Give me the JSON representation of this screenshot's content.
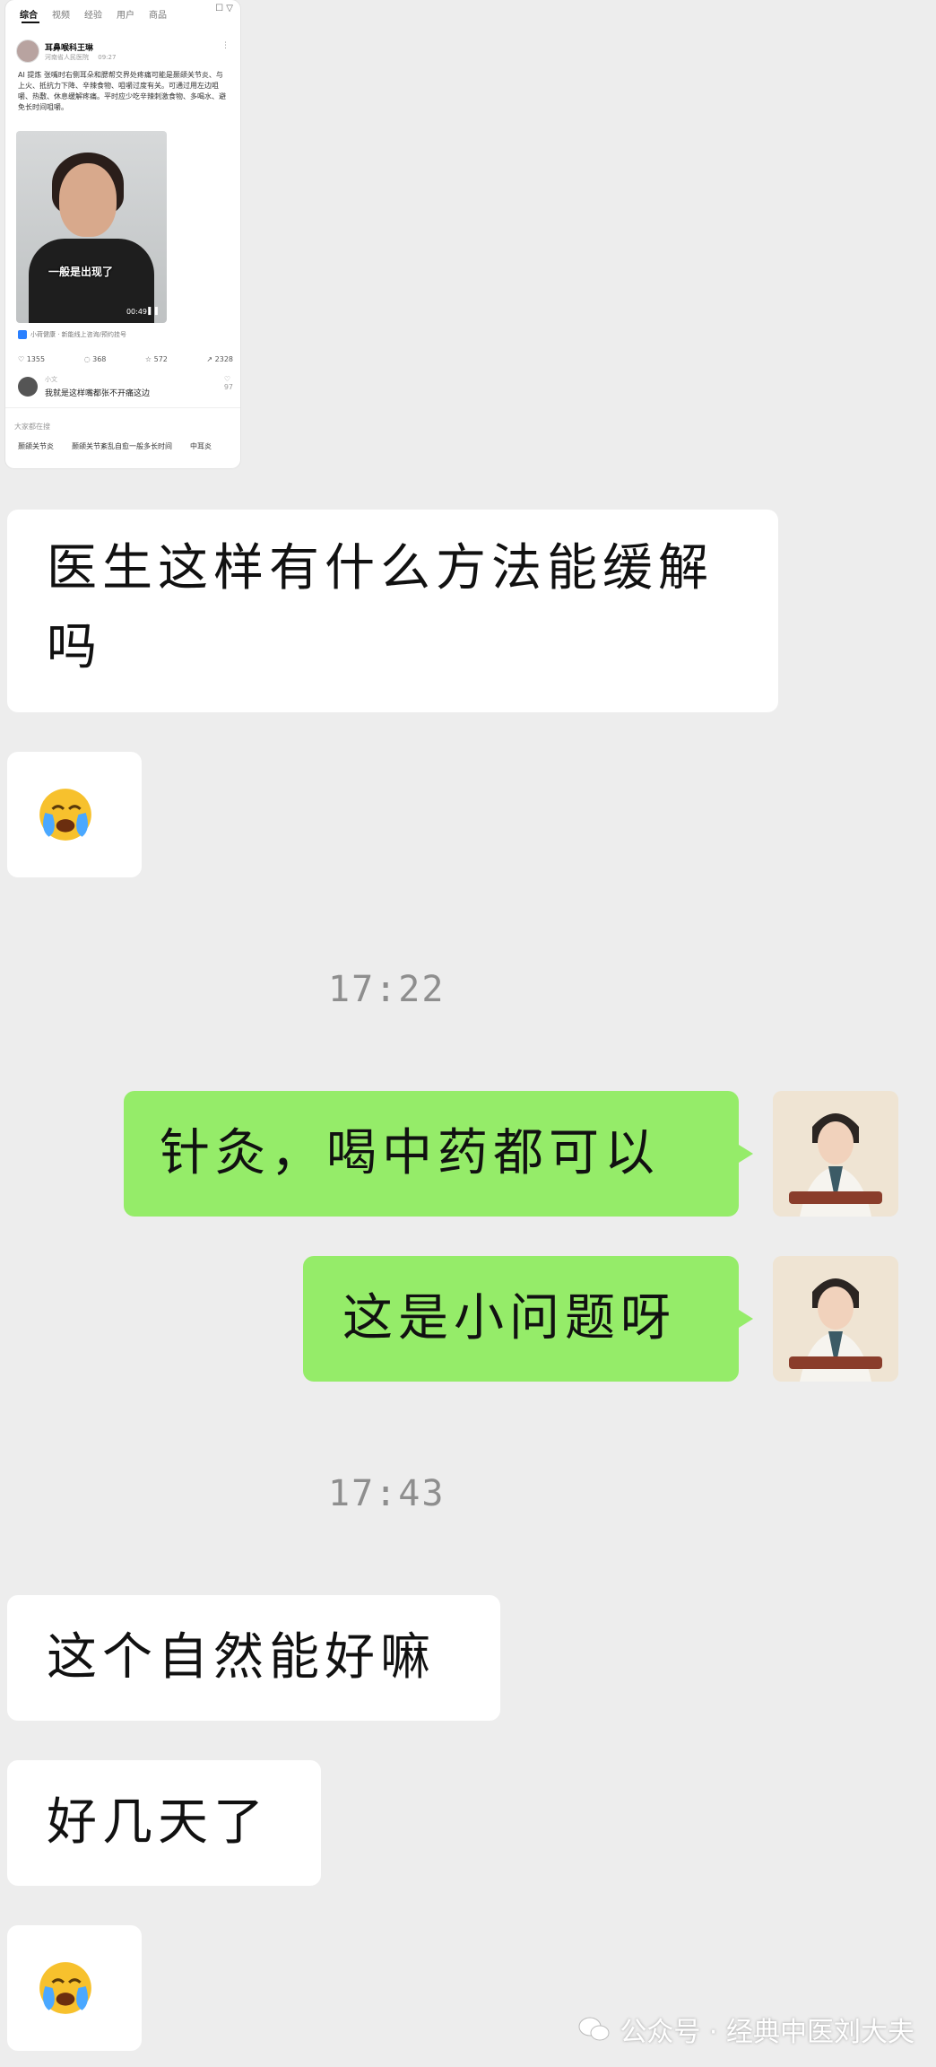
{
  "shared_post": {
    "tabs": [
      "综合",
      "视频",
      "经验",
      "用户",
      "商品"
    ],
    "author": "耳鼻喉科王琳",
    "author_meta": "河南省人民医院",
    "post_time": "09:27",
    "text": "AI 提炼 张嘴时右侧耳朵和腮帮交界处疼痛可能是颞颌关节炎、与上火、抵抗力下降、辛辣食物、咀嚼过度有关。可通过用左边咀嚼、热敷、休息缓解疼痛。平时应少吃辛辣刺激食物、多喝水、避免长时间咀嚼。",
    "video_caption": "一般是出现了",
    "video_time": "00:49",
    "mini_app_label": "小荷健康 · 新能线上咨询/预约挂号",
    "stats": {
      "likes": "1355",
      "comments": "368",
      "favorites": "572",
      "shares": "2328"
    },
    "comment_user": "小文",
    "comment_text": "我就是这样嘴都张不开痛这边",
    "comment_likes": "97",
    "suggest_header": "大家都在搜",
    "suggestions": [
      "颞颌关节炎",
      "颞颌关节紊乱自愈一般多长时间",
      "中耳炎"
    ]
  },
  "messages": {
    "m1": "医生这样有什么方法能缓解吗",
    "m3": "针灸，喝中药都可以",
    "m4": "这是小问题呀",
    "m5": "这个自然能好嘛",
    "m6": "好几天了"
  },
  "times": [
    "17:22",
    "17:43"
  ],
  "watermark": "公众号 · 经典中医刘大夫",
  "colors": {
    "background": "#ededed",
    "right_bubble": "#95ec69",
    "left_bubble": "#ffffff"
  }
}
